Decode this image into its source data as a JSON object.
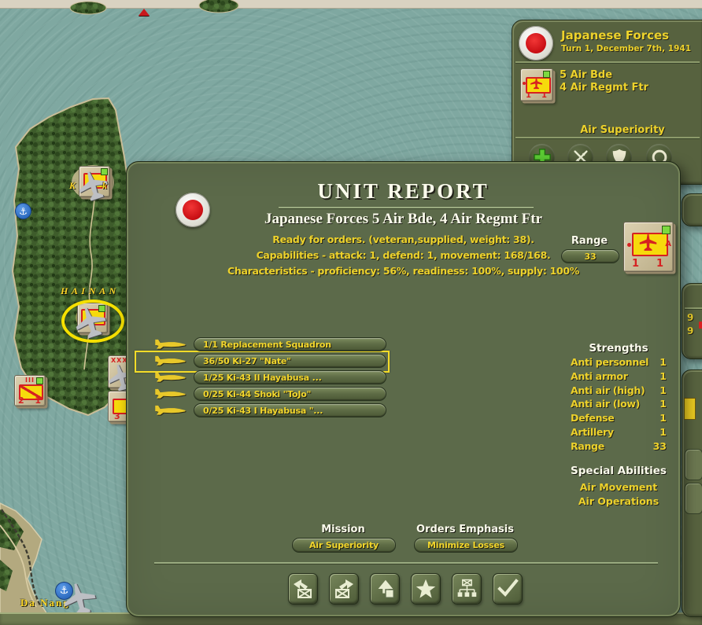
{
  "sidebar": {
    "faction_name": "Japanese Forces",
    "turn_text": "Turn 1, December 7th, 1941",
    "unit_line1": "5 Air Bde",
    "unit_line2": "4 Air Regmt Ftr",
    "mode_label": "Air Superiority",
    "counter": {
      "left_value": "1",
      "right_value": "1"
    },
    "buttons": [
      "add-icon",
      "crossed-swords-icon",
      "shield-icon",
      "circle-icon"
    ]
  },
  "map": {
    "region_label": "H A I N A N",
    "port_label": "Da Nang",
    "city_fragment_left": "K",
    "city_fragment_right": "k",
    "counters": {
      "aa_counter": {
        "top": "III",
        "left": "2",
        "right": "1"
      },
      "edge_counter_top": {
        "top": "XXX"
      },
      "edge_counter_bottom": {
        "value": "3"
      }
    },
    "sliver_values": [
      "9",
      "9"
    ]
  },
  "dialog": {
    "title": "UNIT REPORT",
    "subtitle": "Japanese Forces 5 Air Bde, 4 Air Regmt Ftr",
    "status_lines": [
      "Ready for orders. (veteran,supplied, weight: 38).",
      "Capabilities - attack: 1, defend: 1, movement: 168/168.",
      "Characteristics - proficiency: 56%, readiness: 100%, supply: 100%"
    ],
    "range_label": "Range",
    "range_value": "33",
    "counter": {
      "left_value": "1",
      "right_value": "1",
      "side_letter": "A"
    },
    "squadrons": [
      {
        "label": "1/1 Replacement Squadron",
        "selected": false
      },
      {
        "label": "36/50 Ki-27 \"Nate\"",
        "selected": true
      },
      {
        "label": "1/25 Ki-43 II Hayabusa ...",
        "selected": false
      },
      {
        "label": "0/25 Ki-44 Shoki \"ToJo\"",
        "selected": false
      },
      {
        "label": "0/25 Ki-43 I Hayabusa \"...",
        "selected": false
      }
    ],
    "strengths": {
      "title": "Strengths",
      "rows": [
        {
          "label": "Anti personnel",
          "value": "1"
        },
        {
          "label": "Anti armor",
          "value": "1"
        },
        {
          "label": "Anti air (high)",
          "value": "1"
        },
        {
          "label": "Anti air (low)",
          "value": "1"
        },
        {
          "label": "Defense",
          "value": "1"
        },
        {
          "label": "Artillery",
          "value": "1"
        },
        {
          "label": "Range",
          "value": "33"
        }
      ]
    },
    "special_abilities": {
      "title": "Special Abilities",
      "items": [
        "Air Movement",
        "Air Operations"
      ]
    },
    "mission": {
      "label": "Mission",
      "value": "Air Superiority"
    },
    "orders_emphasis": {
      "label": "Orders Emphasis",
      "value": "Minimize Losses"
    },
    "buttons": [
      "previous-unit-icon",
      "next-unit-icon",
      "parent-unit-icon",
      "star-icon",
      "org-chart-icon",
      "confirm-icon"
    ]
  },
  "colors": {
    "water_teal": "#7FA8A1",
    "panel_olive": "#57623F",
    "dialog_olive": "#5C6A4A",
    "accent_yellow": "#F0D42A",
    "flag_red": "#D01818",
    "highlight_ring": "#F5E000",
    "counter_tan": "#CFC2A0",
    "plus_green": "#52C433"
  }
}
